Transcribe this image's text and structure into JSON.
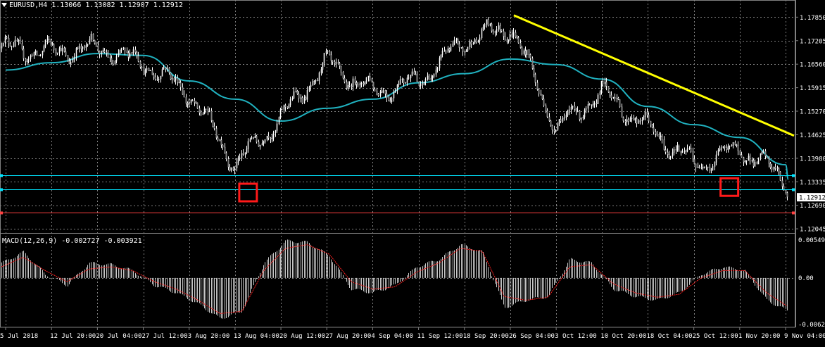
{
  "symbol_header": "EURUSD,H4  1.13066 1.13082 1.12907 1.12912",
  "macd_header": "MACD(12,26,9) -0.002727 -0.003921",
  "colors": {
    "background": "#000000",
    "grid": "#808080",
    "candle": "#ffffff",
    "ma_line": "#20b2c0",
    "trendline": "#ffff00",
    "hline": "#00e5ff",
    "hline_red": "#ff4040",
    "marker_box": "#ff1a1a",
    "macd_hist": "#c8c8c8",
    "macd_signal": "#ff2020",
    "price_badge_bg": "#ffffff",
    "price_badge_fg": "#000000",
    "axis_text": "#ffffff"
  },
  "price_axis": {
    "labels": [
      "1.17850",
      "1.17205",
      "1.16560",
      "1.15915",
      "1.15270",
      "1.14625",
      "1.13980",
      "1.13335",
      "1.12690",
      "1.12045"
    ],
    "current_price": "1.12912"
  },
  "macd_axis": {
    "labels": [
      "0.005499",
      "0.00",
      "-0.006272"
    ]
  },
  "time_axis": {
    "labels": [
      "5 Jul 2018",
      "12 Jul 20:00",
      "20 Jul 04:00",
      "27 Jul 12:00",
      "3 Aug 20:00",
      "13 Aug 04:00",
      "20 Aug 12:00",
      "27 Aug 20:00",
      "4 Sep 04:00",
      "11 Sep 12:00",
      "18 Sep 20:00",
      "26 Sep 04:00",
      "3 Oct 12:00",
      "10 Oct 20:00",
      "18 Oct 04:00",
      "25 Oct 12:00",
      "1 Nov 20:00",
      "9 Nov 04:00"
    ]
  },
  "chart_data": [
    {
      "type": "candlestick",
      "title": "EURUSD,H4",
      "ohlc_last": {
        "open": 1.13066,
        "high": 1.13082,
        "low": 1.12907,
        "close": 1.12912
      },
      "ylim": [
        1.1195,
        1.1805
      ],
      "x_ticks": [
        "5 Jul 2018",
        "12 Jul 20:00",
        "20 Jul 04:00",
        "27 Jul 12:00",
        "3 Aug 20:00",
        "13 Aug 04:00",
        "20 Aug 12:00",
        "27 Aug 20:00",
        "4 Sep 04:00",
        "11 Sep 12:00",
        "18 Sep 20:00",
        "26 Sep 04:00",
        "3 Oct 12:00",
        "10 Oct 20:00",
        "18 Oct 04:00",
        "25 Oct 12:00",
        "1 Nov 20:00",
        "9 Nov 04:00"
      ],
      "close_path": [
        {
          "t": "5 Jul 2018",
          "close": 1.17
        },
        {
          "t": "12 Jul 20:00",
          "close": 1.169
        },
        {
          "t": "20 Jul 04:00",
          "close": 1.17
        },
        {
          "t": "27 Jul 12:00",
          "close": 1.166
        },
        {
          "t": "3 Aug 20:00",
          "close": 1.1575
        },
        {
          "t": "13 Aug 04:00",
          "close": 1.138
        },
        {
          "t": "20 Aug 12:00",
          "close": 1.151
        },
        {
          "t": "27 Aug 20:00",
          "close": 1.166
        },
        {
          "t": "4 Sep 04:00",
          "close": 1.158
        },
        {
          "t": "11 Sep 12:00",
          "close": 1.161
        },
        {
          "t": "18 Sep 20:00",
          "close": 1.172
        },
        {
          "t": "26 Sep 04:00",
          "close": 1.176
        },
        {
          "t": "3 Oct 12:00",
          "close": 1.148
        },
        {
          "t": "10 Oct 20:00",
          "close": 1.158
        },
        {
          "t": "18 Oct 04:00",
          "close": 1.148
        },
        {
          "t": "25 Oct 12:00",
          "close": 1.138
        },
        {
          "t": "1 Nov 20:00",
          "close": 1.1425
        },
        {
          "t": "9 Nov 04:00",
          "close": 1.134
        },
        {
          "t": "end",
          "close": 1.12912
        }
      ],
      "moving_average": [
        {
          "t": "5 Jul 2018",
          "value": 1.164
        },
        {
          "t": "12 Jul 20:00",
          "value": 1.166
        },
        {
          "t": "20 Jul 04:00",
          "value": 1.1685
        },
        {
          "t": "27 Jul 12:00",
          "value": 1.168
        },
        {
          "t": "3 Aug 20:00",
          "value": 1.161
        },
        {
          "t": "13 Aug 04:00",
          "value": 1.156
        },
        {
          "t": "20 Aug 12:00",
          "value": 1.15
        },
        {
          "t": "27 Aug 20:00",
          "value": 1.1535
        },
        {
          "t": "4 Sep 04:00",
          "value": 1.156
        },
        {
          "t": "11 Sep 12:00",
          "value": 1.1605
        },
        {
          "t": "18 Sep 20:00",
          "value": 1.163
        },
        {
          "t": "26 Sep 04:00",
          "value": 1.167
        },
        {
          "t": "3 Oct 12:00",
          "value": 1.1655
        },
        {
          "t": "10 Oct 20:00",
          "value": 1.1615
        },
        {
          "t": "18 Oct 04:00",
          "value": 1.154
        },
        {
          "t": "25 Oct 12:00",
          "value": 1.149
        },
        {
          "t": "1 Nov 20:00",
          "value": 1.1455
        },
        {
          "t": "9 Nov 04:00",
          "value": 1.138
        }
      ],
      "trendline": {
        "from": {
          "t": "26 Sep 04:00",
          "price": 1.179
        },
        "to": {
          "t": "end",
          "price": 1.146
        }
      },
      "horizontal_lines": [
        {
          "price": 1.1352,
          "color": "cyan"
        },
        {
          "price": 1.1312,
          "color": "cyan"
        },
        {
          "price": 1.125,
          "color": "red"
        }
      ],
      "marked_lows": [
        {
          "t": "13 Aug 04:00",
          "price": 1.1305
        },
        {
          "t": "25 Oct 12:00",
          "price": 1.132
        }
      ]
    },
    {
      "type": "bar",
      "title": "MACD(12,26,9) -0.002727 -0.003921",
      "ylim": [
        -0.006272,
        0.005499
      ],
      "series": [
        {
          "name": "MACD",
          "values": [
            0.002,
            0.0035,
            0.0005,
            -0.001,
            0.002,
            0.0018,
            0.001,
            -0.001,
            -0.002,
            -0.0035,
            -0.0055,
            -0.0045,
            0.002,
            0.005,
            0.0048,
            0.003,
            -0.0015,
            -0.002,
            -0.001,
            0.0015,
            0.0025,
            0.0045,
            0.0035,
            -0.004,
            -0.003,
            -0.0025,
            0.0025,
            0.002,
            -0.0015,
            -0.0025,
            -0.003,
            -0.002,
            0.0005,
            0.0015,
            0.001,
            -0.003,
            -0.0045
          ]
        },
        {
          "name": "Signal",
          "values": [
            0.0015,
            0.0028,
            0.001,
            -0.0005,
            0.0012,
            0.0015,
            0.001,
            -0.0005,
            -0.0015,
            -0.003,
            -0.0048,
            -0.0045,
            0.001,
            0.004,
            0.0045,
            0.0032,
            -0.0005,
            -0.0015,
            -0.0012,
            0.0008,
            0.002,
            0.004,
            0.0036,
            -0.0025,
            -0.003,
            -0.0026,
            0.0015,
            0.0018,
            -0.0008,
            -0.002,
            -0.0026,
            -0.0022,
            0.0,
            0.001,
            0.001,
            -0.002,
            -0.0039
          ]
        }
      ]
    }
  ]
}
